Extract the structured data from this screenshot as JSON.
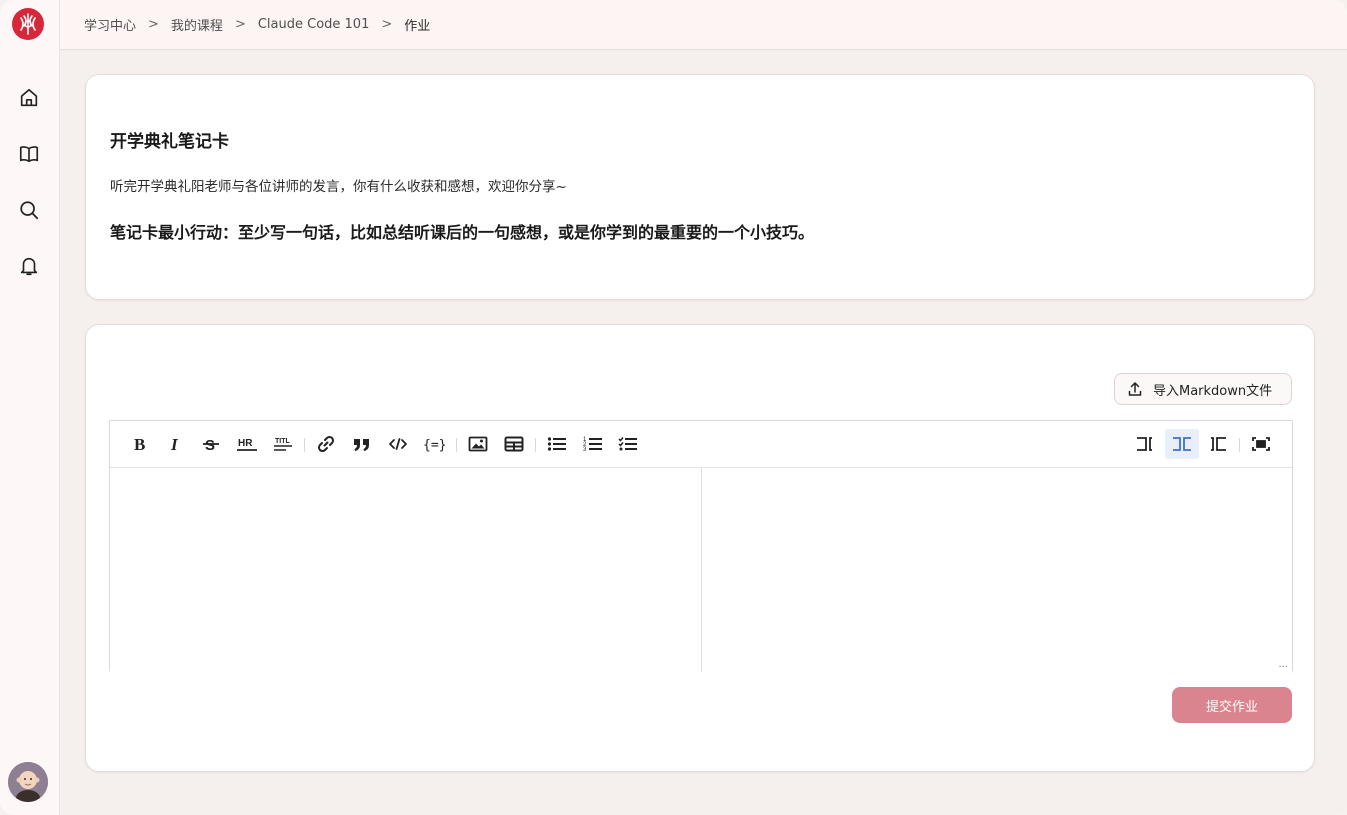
{
  "breadcrumb": [
    "学习中心",
    "我的课程",
    "Claude Code 101",
    "作业"
  ],
  "breadcrumb_separator": ">",
  "nav_icons": [
    "home-icon",
    "book-icon",
    "search-icon",
    "bell-icon"
  ],
  "assignment": {
    "title": "开学典礼笔记卡",
    "description": "听完开学典礼阳老师与各位讲师的发言，你有什么收获和感想，欢迎你分享~",
    "minimum_action": "笔记卡最小行动：至少写一句话，比如总结听课后的一句感想，或是你学到的最重要的一个小技巧。"
  },
  "editor": {
    "import_label": "导入Markdown文件",
    "toolbar_left": [
      "bold",
      "italic",
      "strikethrough",
      "hr",
      "title",
      "link",
      "quote",
      "code",
      "code-block",
      "image",
      "table",
      "unordered-list",
      "ordered-list",
      "task-list"
    ],
    "toolbar_right": [
      "editor-only",
      "split-view",
      "preview-only",
      "fullscreen"
    ],
    "active_view": "split-view",
    "content": "",
    "resize_handle": "..."
  },
  "submit_label": "提交作业",
  "colors": {
    "brand": "#d6283a",
    "submit": "#d9848e",
    "active_view": "#3c6fd8"
  }
}
